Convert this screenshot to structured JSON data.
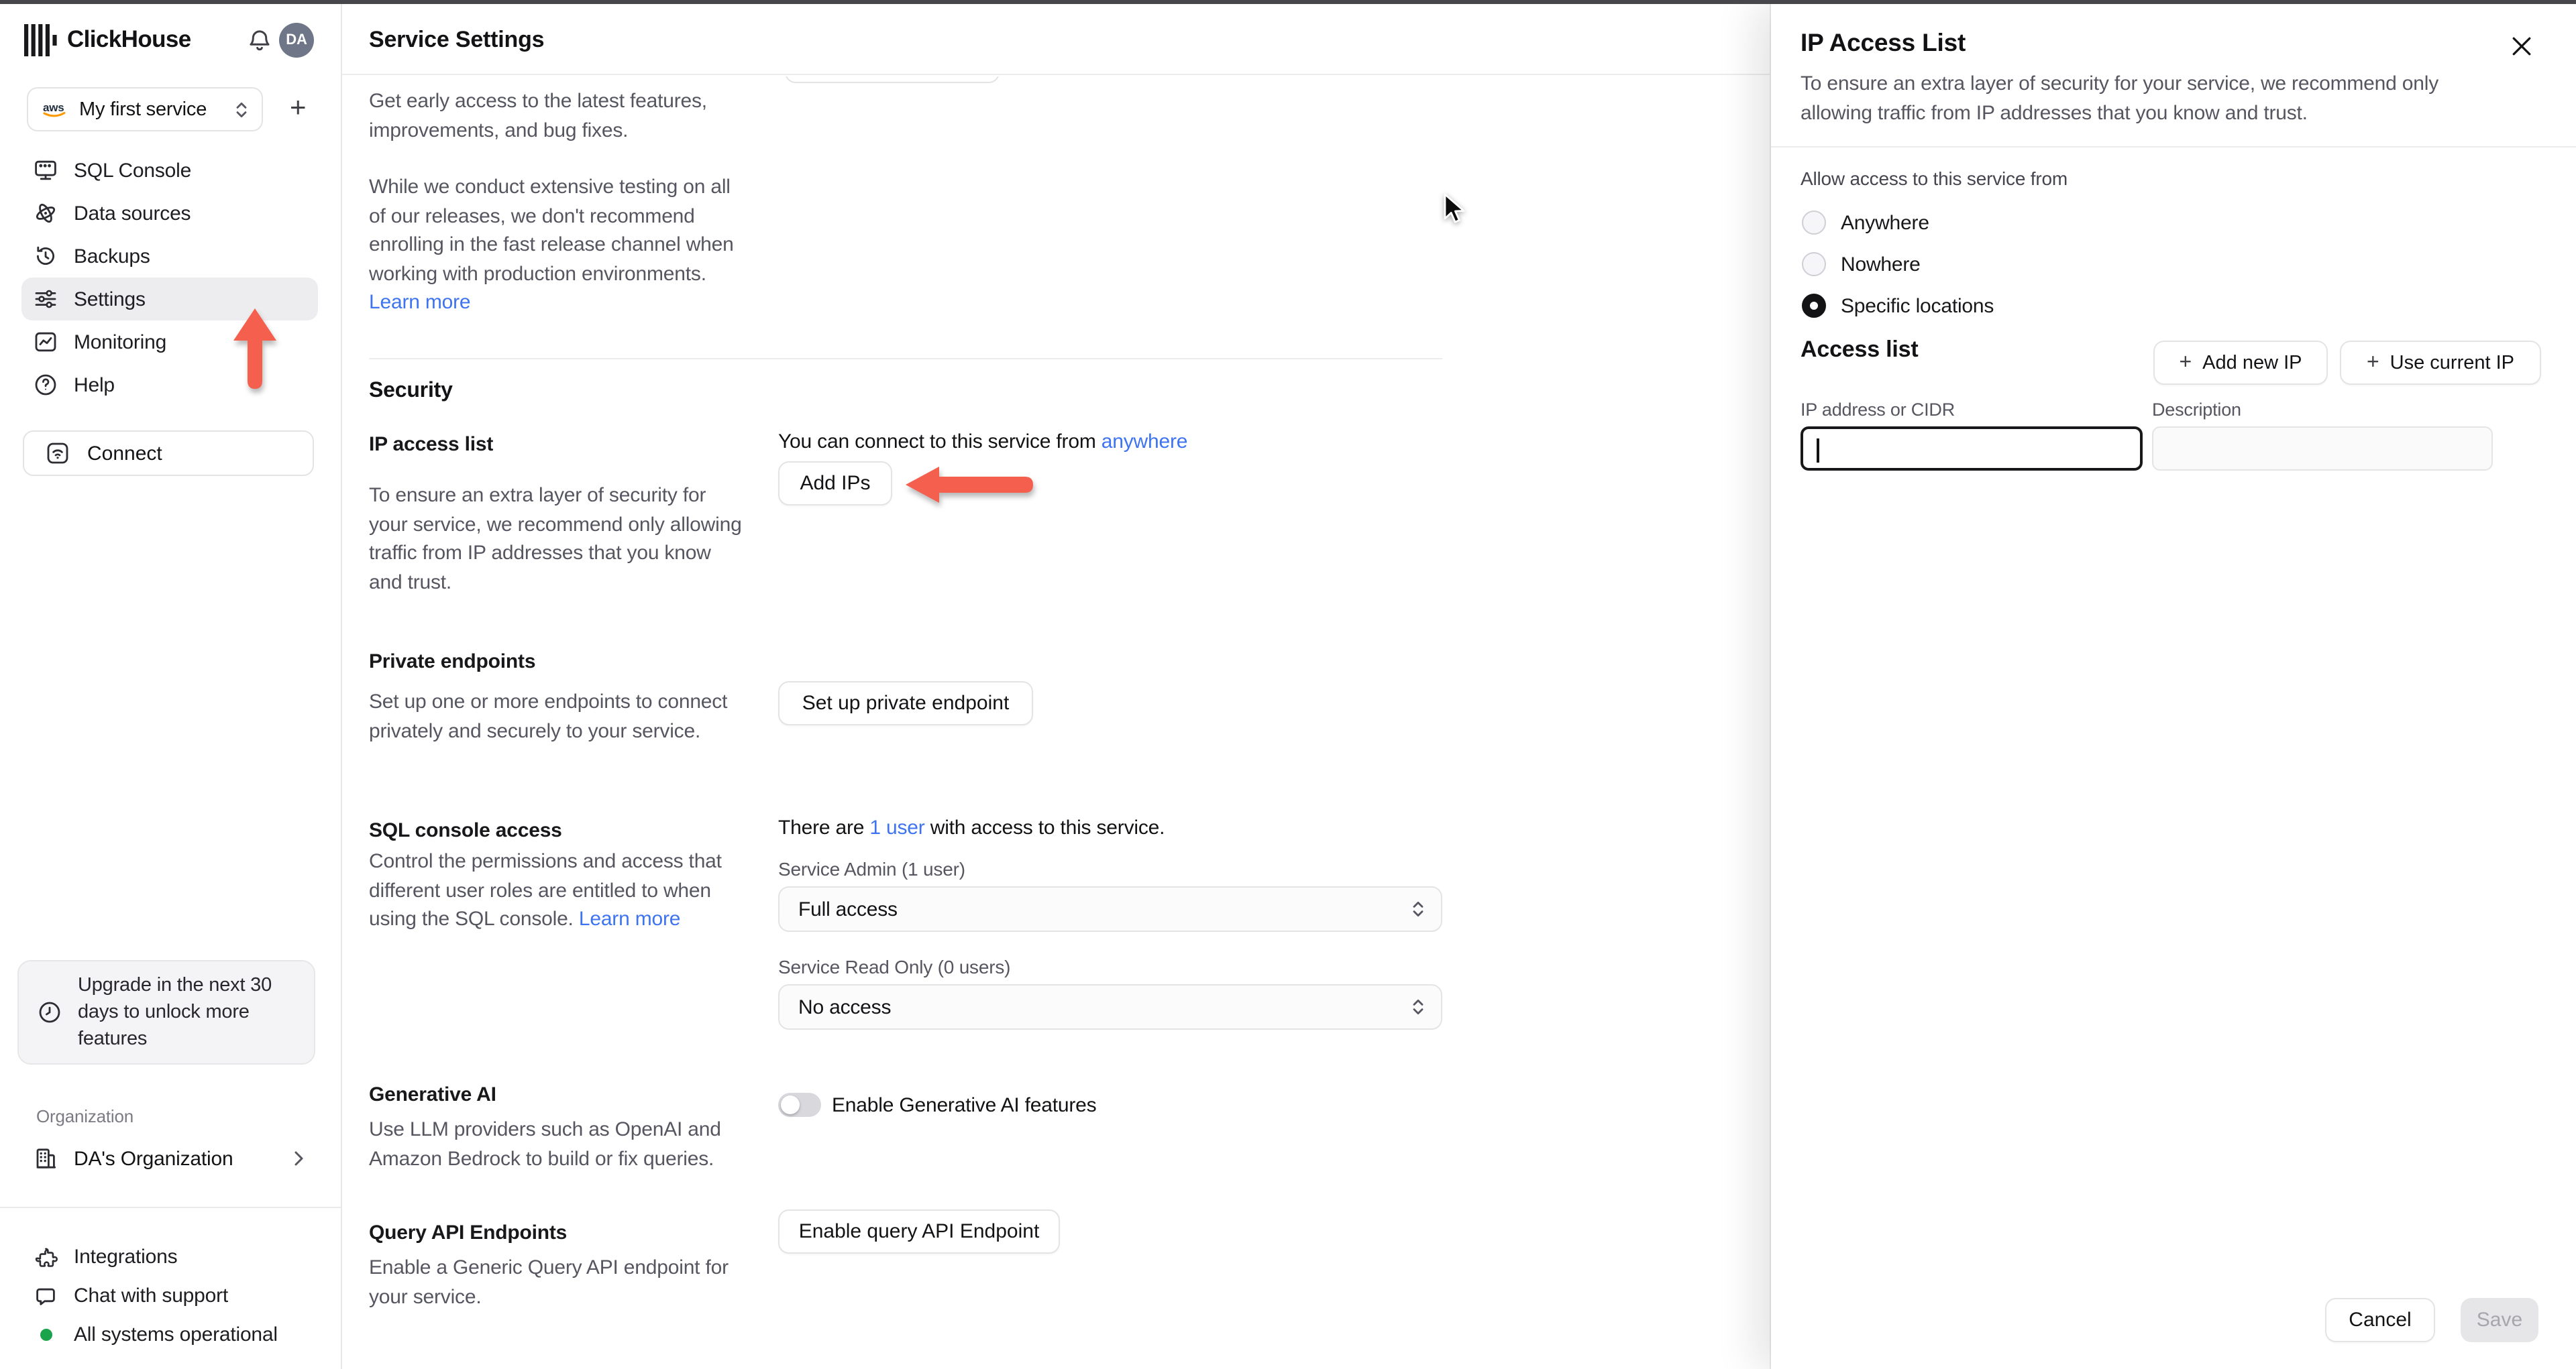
{
  "colors": {
    "annotation_arrow": "#f4604d",
    "link": "#3e74f0",
    "status_ok_green": "#1aa34a",
    "avatar_bg": "#6e7687"
  },
  "sidebar": {
    "brand": "ClickHouse",
    "avatar_initials": "DA",
    "add_service_label": "+",
    "service_selector": {
      "provider": "aws",
      "label": "My first service"
    },
    "nav": [
      {
        "label": "SQL Console"
      },
      {
        "label": "Data sources"
      },
      {
        "label": "Backups"
      },
      {
        "label": "Settings"
      },
      {
        "label": "Monitoring"
      },
      {
        "label": "Help"
      }
    ],
    "connect_label": "Connect",
    "upgrade_notice": "Upgrade in the next 30 days to unlock more features",
    "organization_label": "Organization",
    "organization_name": "DA's Organization",
    "footer": [
      {
        "label": "Integrations"
      },
      {
        "label": "Chat with support"
      },
      {
        "label": "All systems operational"
      }
    ]
  },
  "main": {
    "title": "Service Settings",
    "release_channel": {
      "p1": "Get early access to the latest features, improvements, and bug fixes.",
      "p2_prefix": "While we conduct extensive testing on all of our releases, we don't recommend enrolling in the fast release channel when working with production environments. ",
      "p2_link": "Learn more"
    },
    "security": {
      "heading": "Security",
      "ip_access": {
        "title": "IP access list",
        "description": "To ensure an extra layer of security for your service, we recommend only allowing traffic from IP addresses that you know and trust.",
        "status_prefix": "You can connect to this service from ",
        "status_link": "anywhere",
        "add_ips_label": "Add IPs"
      },
      "private_endpoints": {
        "title": "Private endpoints",
        "description": "Set up one or more endpoints to connect privately and securely to your service.",
        "button_label": "Set up private endpoint"
      },
      "sql_console": {
        "title": "SQL console access",
        "status_prefix": "There are ",
        "status_link": "1 user",
        "status_suffix": " with access to this service.",
        "description_prefix": "Control the permissions and access that different user roles are entitled to when using the SQL console. ",
        "description_link": "Learn more",
        "admin_label": "Service Admin (1 user)",
        "admin_value": "Full access",
        "readonly_label": "Service Read Only (0 users)",
        "readonly_value": "No access"
      },
      "generative_ai": {
        "title": "Generative AI",
        "description": "Use LLM providers such as OpenAI and Amazon Bedrock to build or fix queries.",
        "toggle_label": "Enable Generative AI features"
      },
      "query_api": {
        "title": "Query API Endpoints",
        "description": "Enable a Generic Query API endpoint for your service.",
        "button_label": "Enable query API Endpoint"
      }
    }
  },
  "drawer": {
    "title": "IP Access List",
    "description": "To ensure an extra layer of security for your service, we recommend only allowing traffic from IP addresses that you know and trust.",
    "allow_label": "Allow access to this service from",
    "radios": [
      {
        "label": "Anywhere"
      },
      {
        "label": "Nowhere"
      },
      {
        "label": "Specific locations"
      }
    ],
    "access_list": {
      "heading": "Access list",
      "add_new_ip_plus": "+",
      "add_new_ip_label": "Add new IP",
      "use_current_ip_plus": "+",
      "use_current_ip_label": "Use current IP",
      "ip_label": "IP address or CIDR",
      "description_label": "Description"
    },
    "footer": {
      "cancel_label": "Cancel",
      "save_label": "Save"
    }
  }
}
